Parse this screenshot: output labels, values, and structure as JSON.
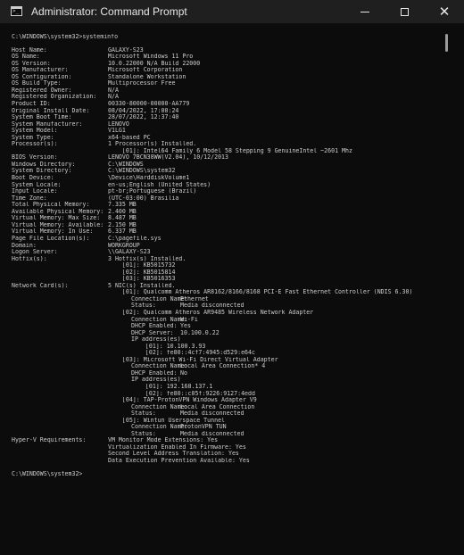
{
  "window": {
    "title": "Administrator: Command Prompt",
    "buttons": {
      "minimize": "minimize",
      "maximize": "maximize",
      "close": "close"
    }
  },
  "console": {
    "prompt_cmd": "C:\\WINDOWS\\system32>systeminfo",
    "fields": [
      {
        "label": "Host Name:",
        "value": "GALAXY-S23"
      },
      {
        "label": "OS Name:",
        "value": "Microsoft Windows 11 Pro"
      },
      {
        "label": "OS Version:",
        "value": "10.0.22000 N/A Build 22000"
      },
      {
        "label": "OS Manufacturer:",
        "value": "Microsoft Corporation"
      },
      {
        "label": "OS Configuration:",
        "value": "Standalone Workstation"
      },
      {
        "label": "OS Build Type:",
        "value": "Multiprocessor Free"
      },
      {
        "label": "Registered Owner:",
        "value": "N/A"
      },
      {
        "label": "Registered Organization:",
        "value": "N/A"
      },
      {
        "label": "Product ID:",
        "value": "00330-80000-00000-AA779"
      },
      {
        "label": "Original Install Date:",
        "value": "08/04/2022, 17:00:24"
      },
      {
        "label": "System Boot Time:",
        "value": "28/07/2022, 12:37:40"
      },
      {
        "label": "System Manufacturer:",
        "value": "LENOVO"
      },
      {
        "label": "System Model:",
        "value": "V1LG1"
      },
      {
        "label": "System Type:",
        "value": "x64-based PC"
      },
      {
        "label": "Processor(s):",
        "value": "1 Processor(s) Installed."
      }
    ],
    "processor_detail": "[01]: Intel64 Family 6 Model 58 Stepping 9 GenuineIntel ~2601 Mhz",
    "fields2": [
      {
        "label": "BIOS Version:",
        "value": "LENOVO 7BCN38WW(V2.04), 10/12/2013"
      },
      {
        "label": "Windows Directory:",
        "value": "C:\\WINDOWS"
      },
      {
        "label": "System Directory:",
        "value": "C:\\WINDOWS\\system32"
      },
      {
        "label": "Boot Device:",
        "value": "\\Device\\HarddiskVolume1"
      },
      {
        "label": "System Locale:",
        "value": "en-us;English (United States)"
      },
      {
        "label": "Input Locale:",
        "value": "pt-br;Portuguese (Brazil)"
      },
      {
        "label": "Time Zone:",
        "value": "(UTC-03:00) Brasilia"
      },
      {
        "label": "Total Physical Memory:",
        "value": "7.335 MB"
      },
      {
        "label": "Available Physical Memory:",
        "value": "2.400 MB"
      },
      {
        "label": "Virtual Memory: Max Size:",
        "value": "8.487 MB"
      },
      {
        "label": "Virtual Memory: Available:",
        "value": "2.150 MB"
      },
      {
        "label": "Virtual Memory: In Use:",
        "value": "6.337 MB"
      },
      {
        "label": "Page File Location(s):",
        "value": "C:\\pagefile.sys"
      },
      {
        "label": "Domain:",
        "value": "WORKGROUP"
      },
      {
        "label": "Logon Server:",
        "value": "\\\\GALAXY-S23"
      },
      {
        "label": "Hotfix(s):",
        "value": "3 Hotfix(s) Installed."
      }
    ],
    "hotfixes": [
      "[01]: KB5015732",
      "[02]: KB5015814",
      "[03]: KB5016353"
    ],
    "network_label": "Network Card(s):",
    "network_value": "5 NIC(s) Installed.",
    "nics": [
      {
        "header": "[01]: Qualcomm Atheros AR8162/8166/8168 PCI-E Fast Ethernet Controller (NDIS 6.30)",
        "props": [
          {
            "label": "Connection Name:",
            "value": "Ethernet"
          },
          {
            "label": "Status:",
            "value": "Media disconnected"
          }
        ]
      },
      {
        "header": "[02]: Qualcomm Atheros AR9485 Wireless Network Adapter",
        "props": [
          {
            "label": "Connection Name:",
            "value": "Wi-Fi"
          },
          {
            "label": "DHCP Enabled:",
            "value": "Yes"
          },
          {
            "label": "DHCP Server:",
            "value": "10.100.0.22"
          },
          {
            "label": "IP address(es)",
            "value": ""
          },
          {
            "label": "[01]:",
            "value": "10.100.3.93"
          },
          {
            "label": "[02]:",
            "value": "fe80::4cf7:4945:d529:e64c"
          }
        ]
      },
      {
        "header": "[03]: Microsoft Wi-Fi Direct Virtual Adapter",
        "props": [
          {
            "label": "Connection Name:",
            "value": "Local Area Connection* 4"
          },
          {
            "label": "DHCP Enabled:",
            "value": "No"
          },
          {
            "label": "IP address(es)",
            "value": ""
          },
          {
            "label": "[01]:",
            "value": "192.168.137.1"
          },
          {
            "label": "[02]:",
            "value": "fe80::c05f:9226:9127:4edd"
          }
        ]
      },
      {
        "header": "[04]: TAP-ProtonVPN Windows Adapter V9",
        "props": [
          {
            "label": "Connection Name:",
            "value": "Local Area Connection"
          },
          {
            "label": "Status:",
            "value": "Media disconnected"
          }
        ]
      },
      {
        "header": "[05]: Wintun Userspace Tunnel",
        "props": [
          {
            "label": "Connection Name:",
            "value": "ProtonVPN TUN"
          },
          {
            "label": "Status:",
            "value": "Media disconnected"
          }
        ]
      }
    ],
    "hyperv_label": "Hyper-V Requirements:",
    "hyperv": [
      "VM Monitor Mode Extensions: Yes",
      "Virtualization Enabled In Firmware: Yes",
      "Second Level Address Translation: Yes",
      "Data Execution Prevention Available: Yes"
    ],
    "final_prompt": "C:\\WINDOWS\\system32>"
  }
}
